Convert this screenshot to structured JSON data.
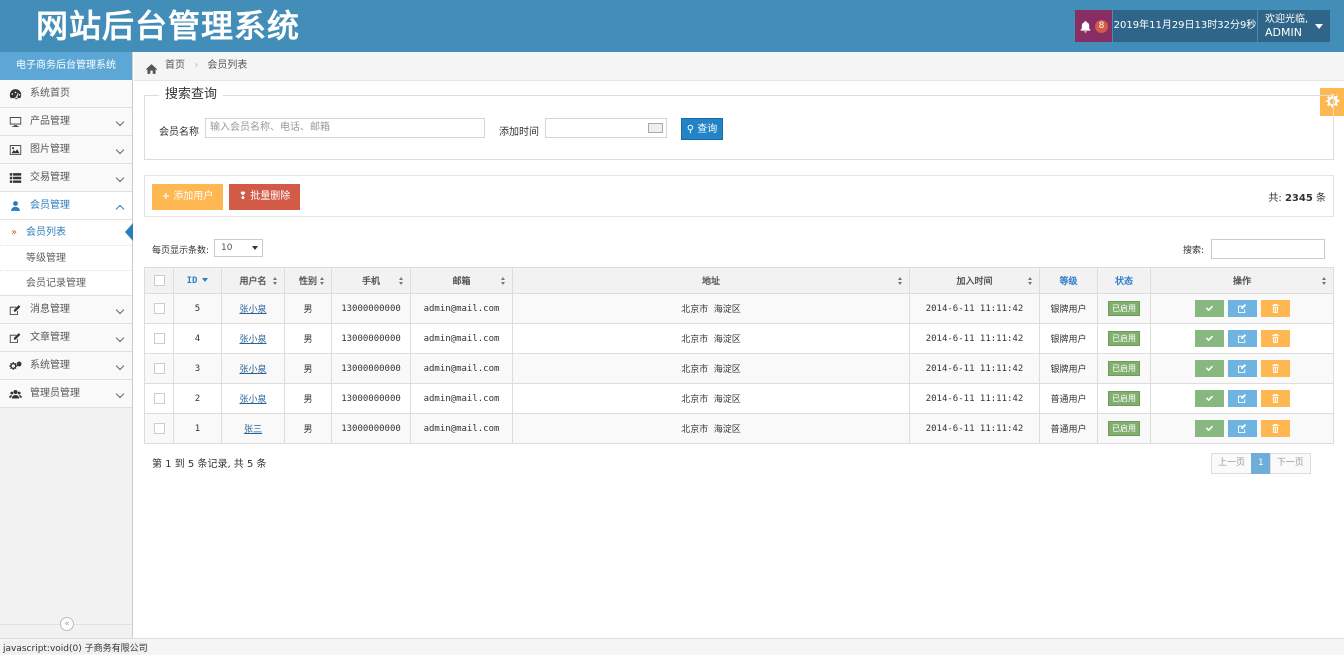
{
  "header": {
    "logo": "网站后台管理系统",
    "notification_count": "8",
    "datetime": "2019年11月29日13时32分9秒",
    "welcome": "欢迎光临,",
    "username": "ADMIN"
  },
  "sidebar": {
    "title": "电子商务后台管理系统",
    "items": [
      {
        "label": "系统首页",
        "icon": "dashboard-icon"
      },
      {
        "label": "产品管理",
        "icon": "desktop-icon"
      },
      {
        "label": "图片管理",
        "icon": "picture-icon"
      },
      {
        "label": "交易管理",
        "icon": "list-icon"
      },
      {
        "label": "会员管理",
        "icon": "user-icon"
      },
      {
        "label": "消息管理",
        "icon": "edit-icon"
      },
      {
        "label": "文章管理",
        "icon": "edit-icon"
      },
      {
        "label": "系统管理",
        "icon": "cogs-icon"
      },
      {
        "label": "管理员管理",
        "icon": "group-icon"
      }
    ],
    "submenu": [
      "会员列表",
      "等级管理",
      "会员记录管理"
    ],
    "collapse_glyph": "«"
  },
  "breadcrumb": {
    "home": "首页",
    "separator": "›",
    "current": "会员列表"
  },
  "search": {
    "legend": "搜索查询",
    "name_label": "会员名称",
    "name_placeholder": "输入会员名称、电话、邮箱",
    "time_label": "添加时间",
    "query_button": "查询"
  },
  "toolbar": {
    "add_button": "添加用户",
    "batch_delete_button": "批量删除",
    "total_prefix": "共:",
    "total_count": "2345",
    "total_suffix": "条"
  },
  "table_controls": {
    "length_label": "每页显示条数:",
    "length_value": "10",
    "filter_label": "搜索:"
  },
  "table": {
    "columns": [
      "ID",
      "用户名",
      "性别",
      "手机",
      "邮箱",
      "地址",
      "加入时间",
      "等级",
      "状态",
      "操作"
    ],
    "rows": [
      {
        "id": "5",
        "name": "张小泉",
        "gender": "男",
        "phone": "13000000000",
        "email": "admin@mail.com",
        "address": "北京市 海淀区",
        "joined": "2014-6-11 11:11:42",
        "level": "银牌用户",
        "status": "已启用"
      },
      {
        "id": "4",
        "name": "张小泉",
        "gender": "男",
        "phone": "13000000000",
        "email": "admin@mail.com",
        "address": "北京市 海淀区",
        "joined": "2014-6-11 11:11:42",
        "level": "银牌用户",
        "status": "已启用"
      },
      {
        "id": "3",
        "name": "张小泉",
        "gender": "男",
        "phone": "13000000000",
        "email": "admin@mail.com",
        "address": "北京市 海淀区",
        "joined": "2014-6-11 11:11:42",
        "level": "银牌用户",
        "status": "已启用"
      },
      {
        "id": "2",
        "name": "张小泉",
        "gender": "男",
        "phone": "13000000000",
        "email": "admin@mail.com",
        "address": "北京市 海淀区",
        "joined": "2014-6-11 11:11:42",
        "level": "普通用户",
        "status": "已启用"
      },
      {
        "id": "1",
        "name": "张三",
        "gender": "男",
        "phone": "13000000000",
        "email": "admin@mail.com",
        "address": "北京市 海淀区",
        "joined": "2014-6-11 11:11:42",
        "level": "普通用户",
        "status": "已启用"
      }
    ]
  },
  "footer": {
    "info": "第 1 到 5 条记录, 共 5 条",
    "prev": "上一页",
    "page": "1",
    "next": "下一页"
  },
  "statusbar": {
    "text": "javascript:void(0) 子商务有限公司"
  },
  "colors": {
    "header_bg": "#438eb9",
    "sidebar_title_bg": "#5ca7d6",
    "notify_bg": "#892e65",
    "status_green": "#82af6f",
    "add_orange": "#ffb752",
    "delete_red": "#d15b47",
    "query_blue": "#2283c5"
  }
}
